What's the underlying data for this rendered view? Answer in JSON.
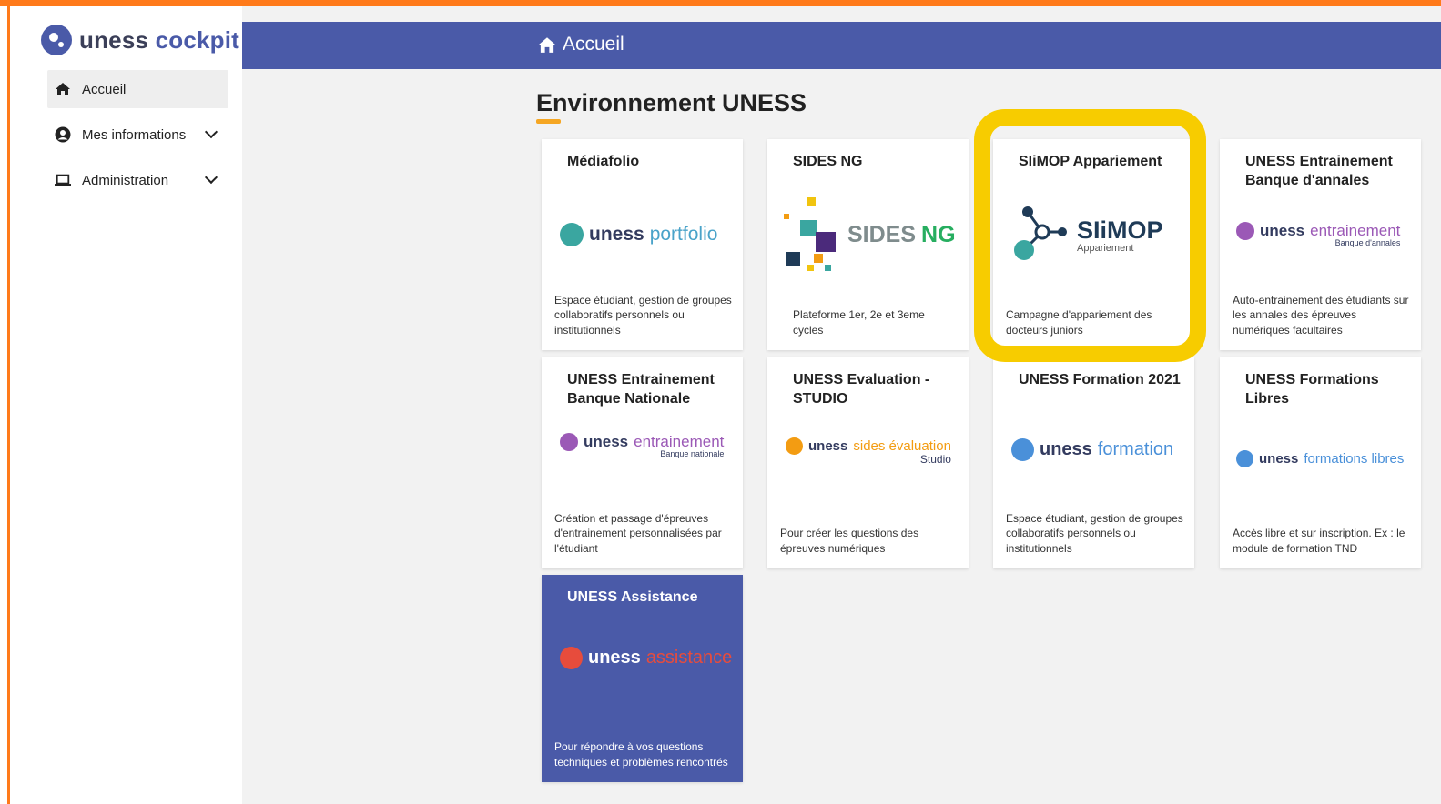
{
  "app": {
    "logo_word1": "uness",
    "logo_word2": "cockpit"
  },
  "sidebar": {
    "items": [
      {
        "label": "Accueil",
        "icon": "home-icon"
      },
      {
        "label": "Mes informations",
        "icon": "user-circle-icon"
      },
      {
        "label": "Administration",
        "icon": "laptop-icon"
      }
    ]
  },
  "header": {
    "title": "Accueil",
    "icon": "home-icon"
  },
  "section": {
    "title": "Environnement UNESS"
  },
  "cards": [
    {
      "title": "Médiafolio",
      "logo_a": "uness",
      "logo_b": "portfolio",
      "logo_sub": "",
      "desc": "Espace étudiant, gestion de groupes collaboratifs personnels ou institutionnels"
    },
    {
      "title": "SIDES NG",
      "logo_a": "SIDES",
      "logo_b": "NG",
      "logo_sub": "",
      "desc": "Plateforme 1er, 2e et 3eme cycles"
    },
    {
      "title": "SIiMOP Appariement",
      "logo_a": "SIiMOP",
      "logo_b": "",
      "logo_sub": "Appariement",
      "desc": "Campagne d'appariement des docteurs juniors"
    },
    {
      "title": "UNESS Entrainement Banque d'annales",
      "logo_a": "uness",
      "logo_b": "entrainement",
      "logo_sub": "Banque d'annales",
      "desc": "Auto-entrainement des étudiants sur les annales des épreuves numériques facultaires"
    },
    {
      "title": "UNESS Entrainement Banque Nationale",
      "logo_a": "uness",
      "logo_b": "entrainement",
      "logo_sub": "Banque nationale",
      "desc": "Création et passage d'épreuves d'entrainement personnalisées par l'étudiant"
    },
    {
      "title": "UNESS Evaluation - STUDIO",
      "logo_a": "uness",
      "logo_b": "sides évaluation",
      "logo_sub": "Studio",
      "desc": "Pour créer les questions des épreuves numériques"
    },
    {
      "title": "UNESS Formation 2021",
      "logo_a": "uness",
      "logo_b": "formation",
      "logo_sub": "",
      "desc": "Espace étudiant, gestion de groupes collaboratifs personnels ou institutionnels"
    },
    {
      "title": "UNESS Formations Libres",
      "logo_a": "uness",
      "logo_b": "formations libres",
      "logo_sub": "",
      "desc": "Accès libre et sur inscription. Ex : le module de formation TND"
    },
    {
      "title": "UNESS Assistance",
      "logo_a": "uness",
      "logo_b": "assistance",
      "logo_sub": "",
      "desc": "Pour répondre à vos questions techniques et problèmes rencontrés"
    }
  ],
  "colors": {
    "brand": "#4a5aa8",
    "accent_underline": "#f5a623",
    "highlight": "#f7cc00",
    "frame": "#ff7a1a",
    "portfolio": "#3aa6a0",
    "entrainement": "#9b59b6",
    "sides_ng": "#27ae60",
    "evaluation": "#f39c12",
    "formation": "#4a90d9",
    "assistance": "#e74c3c"
  }
}
